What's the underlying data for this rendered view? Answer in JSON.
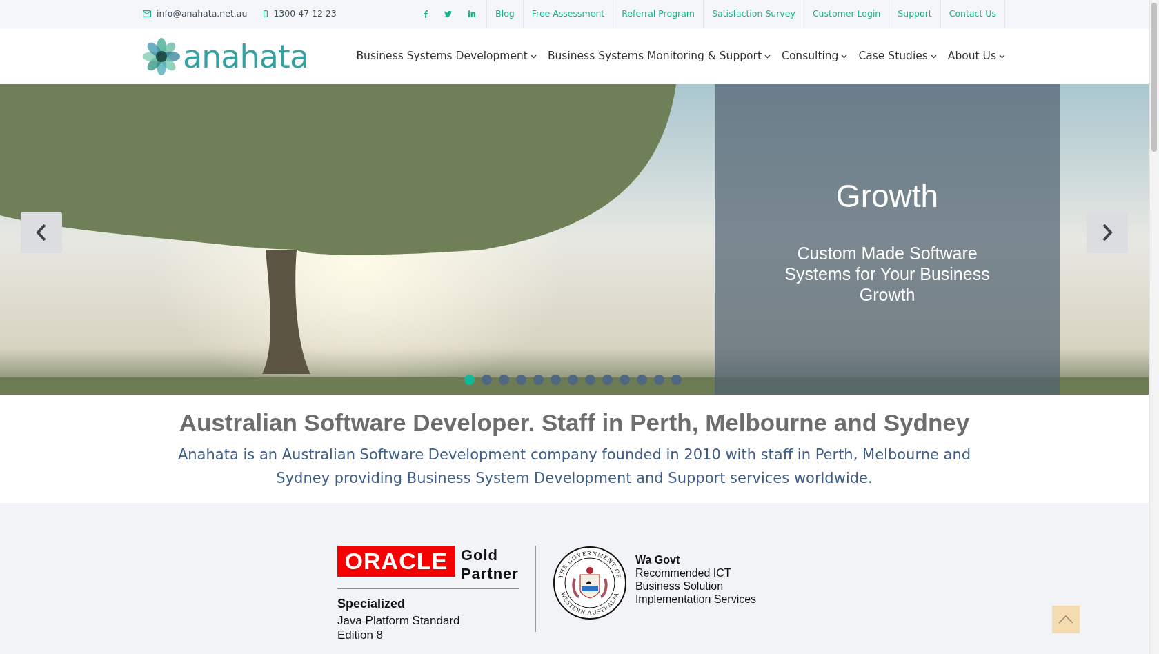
{
  "top_bar": {
    "email": "info@anahata.net.au",
    "phone": "1300 47 12 23",
    "links": [
      "Blog",
      "Free Assessment",
      "Referral Program",
      "Satisfaction Survey",
      "Customer Login",
      "Support",
      "Contact Us"
    ]
  },
  "header": {
    "logo_text": "anahata",
    "nav": [
      "Business Systems Development",
      "Business Systems Monitoring & Support",
      "Consulting",
      "Case Studies",
      "About Us"
    ]
  },
  "slider": {
    "title": "Growth",
    "caption": "Custom Made Software Systems for Your Business Growth",
    "dots": [
      {
        "selected": true
      },
      {
        "selected": false
      },
      {
        "selected": false
      },
      {
        "selected": false
      },
      {
        "selected": false
      },
      {
        "selected": false
      },
      {
        "selected": false
      },
      {
        "selected": false
      },
      {
        "selected": false
      },
      {
        "selected": false
      },
      {
        "selected": false
      },
      {
        "selected": false
      },
      {
        "selected": false
      }
    ]
  },
  "intro": {
    "heading": "Australian Software Developer. Staff in Perth, Melbourne and Sydney",
    "text": "Anahata is an Australian Software Development company founded in 2010 with staff in Perth, Melbourne and Sydney providing Business System Development and Support services worldwide."
  },
  "partners": {
    "oracle": {
      "logo_text": "ORACLE",
      "level": "Gold Partner",
      "specialization": "Specialized",
      "detail": "Java Platform Standard Edition 8"
    },
    "govt": {
      "seal_top": "THE GOVERNMENT OF",
      "seal_bottom": "WESTERN AUSTRALIA",
      "title": "Wa Govt",
      "lines": [
        "Recommended ICT",
        "Business Solution",
        "Implementation Services"
      ]
    }
  }
}
